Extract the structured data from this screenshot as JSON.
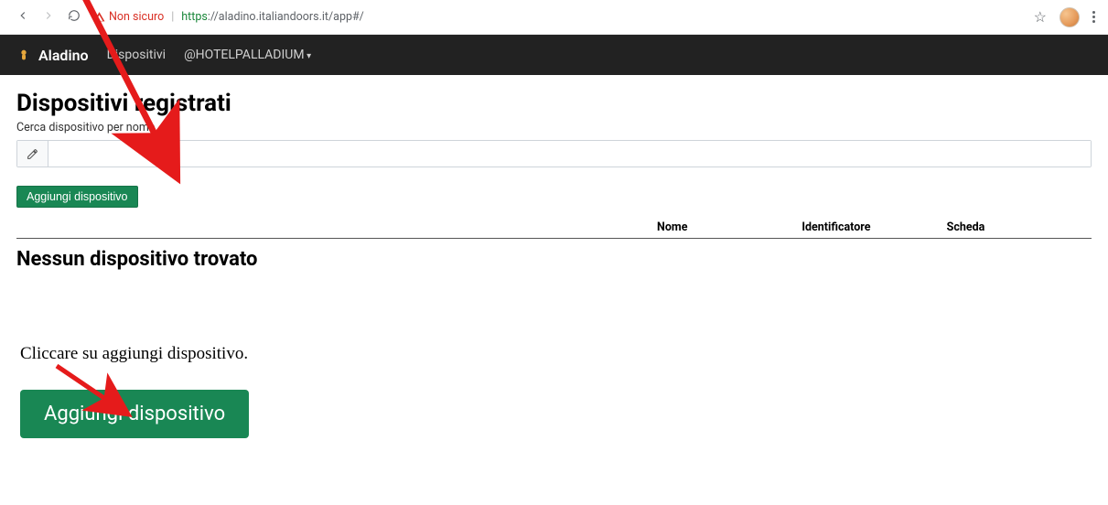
{
  "chrome": {
    "security_label": "Non sicuro",
    "url_prefix": "https",
    "url_rest": "://aladino.italiandoors.it/app#/"
  },
  "navbar": {
    "brand": "Aladino",
    "link_devices": "Dispositivi",
    "link_account": "@HOTELPALLADIUM"
  },
  "main": {
    "title": "Dispositivi registrati",
    "search_label": "Cerca dispositivo per nome",
    "search_value": "",
    "add_button": "Aggiungi dispositivo",
    "columns": {
      "nome": "Nome",
      "identificatore": "Identificatore",
      "scheda": "Scheda"
    },
    "empty": "Nessun dispositivo trovato"
  },
  "instruction": {
    "text": "Cliccare su aggiungi dispositivo.",
    "big_button": "Aggiungi dispositivo"
  }
}
